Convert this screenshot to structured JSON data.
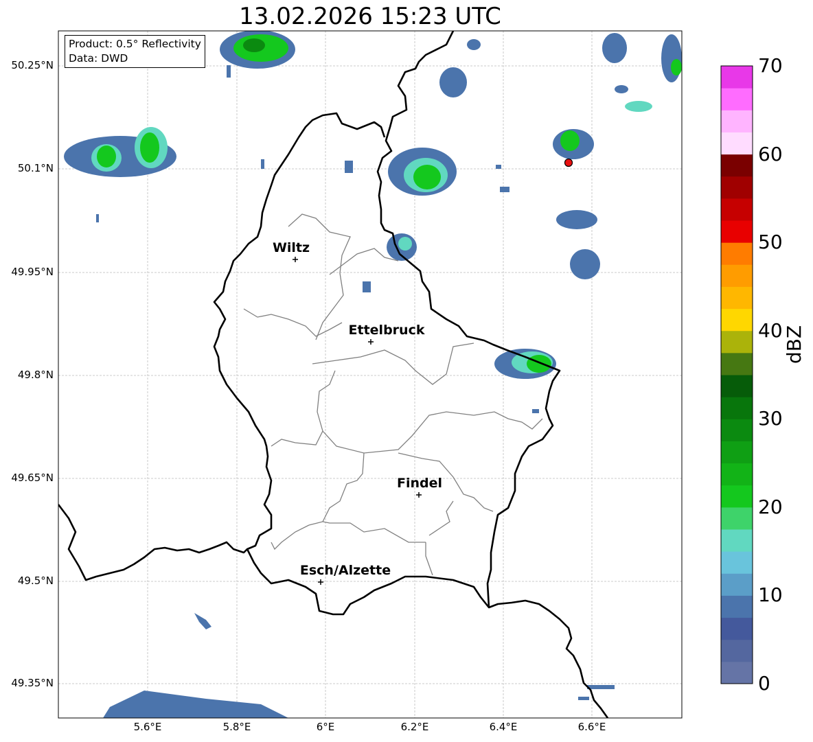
{
  "title": "13.02.2026 15:23 UTC",
  "info": {
    "product": "Product: 0.5° Reflectivity",
    "source": "Data: DWD"
  },
  "axes": {
    "lat_labels": [
      "50.25°N",
      "50.1°N",
      "49.95°N",
      "49.8°N",
      "49.65°N",
      "49.5°N",
      "49.35°N"
    ],
    "lon_labels": [
      "5.6°E",
      "5.8°E",
      "6°E",
      "6.2°E",
      "6.4°E",
      "6.6°E"
    ],
    "gridlines": true
  },
  "cities": [
    {
      "name": "Wiltz"
    },
    {
      "name": "Ettelbruck"
    },
    {
      "name": "Findel"
    },
    {
      "name": "Esch/Alzette"
    }
  ],
  "colorbar": {
    "label": "dBZ",
    "ticks": [
      "0",
      "10",
      "20",
      "30",
      "40",
      "50",
      "60",
      "70"
    ],
    "colors": [
      "#6574a6",
      "#54679f",
      "#44599c",
      "#4b74ac",
      "#5b9ec8",
      "#69c4dc",
      "#61d8c0",
      "#3ed36a",
      "#14c81e",
      "#12b317",
      "#0f9f14",
      "#0b8a10",
      "#08760c",
      "#065c09",
      "#467812",
      "#abb30a",
      "#ffd700",
      "#ffb700",
      "#ff9c00",
      "#ff7c00",
      "#e80000",
      "#c60000",
      "#a00000",
      "#7a0000",
      "#ffdcff",
      "#ffb4ff",
      "#ff6cff",
      "#e838e8"
    ]
  },
  "radar_site_color": "#e81010"
}
